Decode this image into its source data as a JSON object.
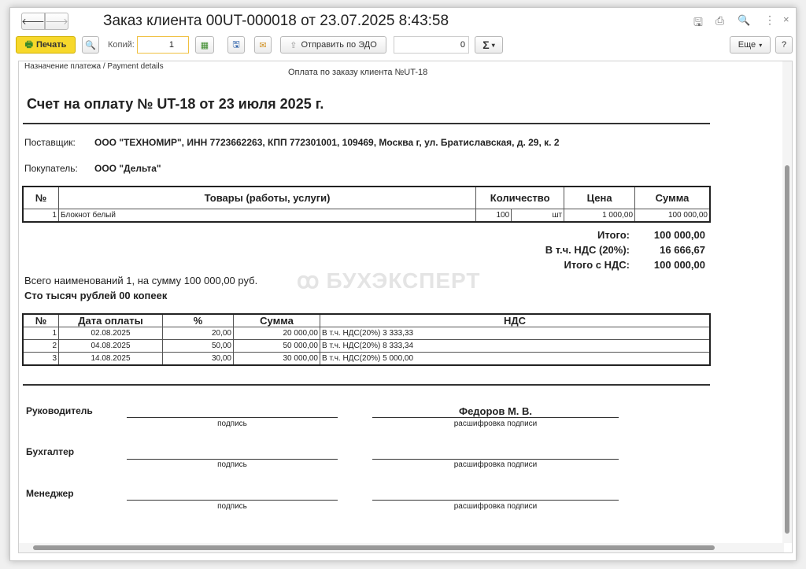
{
  "window": {
    "title": "Заказ клиента 00UT-000018 от 23.07.2025 8:43:58"
  },
  "toolbar": {
    "print": "Печать",
    "copies_label": "Копий:",
    "copies": "1",
    "send_edo": "Отправить по ЭДО",
    "sum_value": "0",
    "sigma": "Σ",
    "more": "Еще",
    "help": "?"
  },
  "doc": {
    "payment_details_label": "Назначение платежа / Payment details",
    "payment_details": "Оплата по заказу клиента №UT-18",
    "heading": "Счет на оплату № UT-18 от 23 июля 2025 г.",
    "supplier_label": "Поставщик:",
    "supplier": "ООО \"ТЕХНОМИР\", ИНН 7723662263, КПП 772301001, 109469, Москва г, ул. Братиславская, д. 29, к. 2",
    "buyer_label": "Покупатель:",
    "buyer": "ООО \"Дельта\"",
    "goods_headers": [
      "№",
      "Товары (работы, услуги)",
      "Количество",
      "Цена",
      "Сумма"
    ],
    "goods": [
      {
        "n": "1",
        "name": "Блокнот белый",
        "qty": "100",
        "unit": "шт",
        "price": "1 000,00",
        "sum": "100 000,00"
      }
    ],
    "totals": [
      {
        "label": "Итого:",
        "value": "100 000,00"
      },
      {
        "label": "В т.ч. НДС (20%):",
        "value": "16 666,67"
      },
      {
        "label": "Итого с НДС:",
        "value": "100 000,00"
      }
    ],
    "summary": "Всего наименований 1, на сумму 100 000,00 руб.",
    "amount_words": "Сто тысяч рублей 00 копеек",
    "watermark": "БУХЭКСПЕРТ",
    "pay_headers": [
      "№",
      "Дата оплаты",
      "%",
      "Сумма",
      "НДС"
    ],
    "payments": [
      {
        "n": "1",
        "date": "02.08.2025",
        "pct": "20,00",
        "sum": "20 000,00",
        "vat": "В т.ч. НДС(20%) 3 333,33"
      },
      {
        "n": "2",
        "date": "04.08.2025",
        "pct": "50,00",
        "sum": "50 000,00",
        "vat": "В т.ч. НДС(20%) 8 333,34"
      },
      {
        "n": "3",
        "date": "14.08.2025",
        "pct": "30,00",
        "sum": "30 000,00",
        "vat": "В т.ч. НДС(20%) 5 000,00"
      }
    ],
    "signatures": [
      {
        "role": "Руководитель",
        "sign": "подпись",
        "name": "Федоров М. В.",
        "decode": "расшифровка подписи"
      },
      {
        "role": "Бухгалтер",
        "sign": "подпись",
        "name": "",
        "decode": "расшифровка подписи"
      },
      {
        "role": "Менеджер",
        "sign": "подпись",
        "name": "",
        "decode": "расшифровка подписи"
      }
    ]
  }
}
